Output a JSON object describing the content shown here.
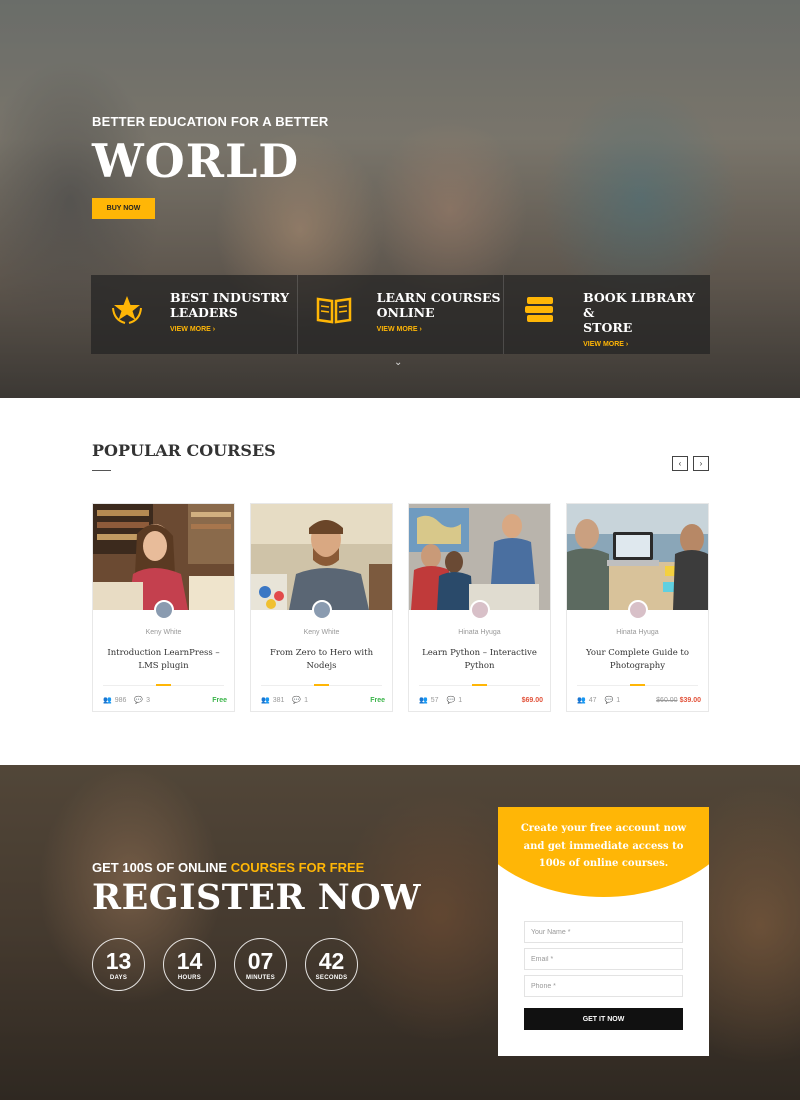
{
  "colors": {
    "accent": "#ffb606",
    "free": "#3bb54a",
    "price": "#e2533b",
    "dark": "#111111"
  },
  "hero": {
    "subtitle": "BETTER EDUCATION FOR A BETTER",
    "title": "WORLD",
    "buy_button": "BUY NOW",
    "features": [
      {
        "icon": "star-laurel-icon",
        "title": "BEST INDUSTRY LEADERS",
        "title_line1": "BEST INDUSTRY",
        "title_line2": "LEADERS",
        "link": "VIEW MORE"
      },
      {
        "icon": "open-book-icon",
        "title": "LEARN COURSES ONLINE",
        "title_line1": "LEARN COURSES",
        "title_line2": "ONLINE",
        "link": "VIEW MORE"
      },
      {
        "icon": "book-stack-icon",
        "title": "BOOK LIBRARY & STORE",
        "title_line1": "BOOK LIBRARY &",
        "title_line2": "STORE",
        "link": "VIEW MORE"
      }
    ]
  },
  "popular": {
    "title": "POPULAR COURSES",
    "prev_label": "‹",
    "next_label": "›",
    "courses": [
      {
        "author": "Keny White",
        "title": "Introduction LearnPress – LMS plugin",
        "students": "986",
        "comments": "3",
        "price": "Free",
        "old_price": ""
      },
      {
        "author": "Keny White",
        "title": "From Zero to Hero with Nodejs",
        "students": "381",
        "comments": "1",
        "price": "Free",
        "old_price": ""
      },
      {
        "author": "Hinata Hyuga",
        "title": "Learn Python – Interactive Python",
        "students": "57",
        "comments": "1",
        "price": "$69.00",
        "old_price": ""
      },
      {
        "author": "Hinata Hyuga",
        "title": "Your Complete Guide to Photography",
        "students": "47",
        "comments": "1",
        "price": "$39.00",
        "old_price": "$60.00"
      }
    ]
  },
  "register": {
    "subtitle_prefix": "GET 100S OF ONLINE ",
    "subtitle_highlight": "COURSES FOR FREE",
    "title": "REGISTER NOW",
    "countdown": [
      {
        "value": "13",
        "label": "DAYS"
      },
      {
        "value": "14",
        "label": "HOURS"
      },
      {
        "value": "07",
        "label": "MINUTES"
      },
      {
        "value": "42",
        "label": "SECONDS"
      }
    ],
    "form": {
      "heading": "Create your free account now and get immediate access to 100s of online courses.",
      "name_placeholder": "Your Name *",
      "email_placeholder": "Email *",
      "phone_placeholder": "Phone *",
      "submit": "GET IT NOW"
    }
  }
}
